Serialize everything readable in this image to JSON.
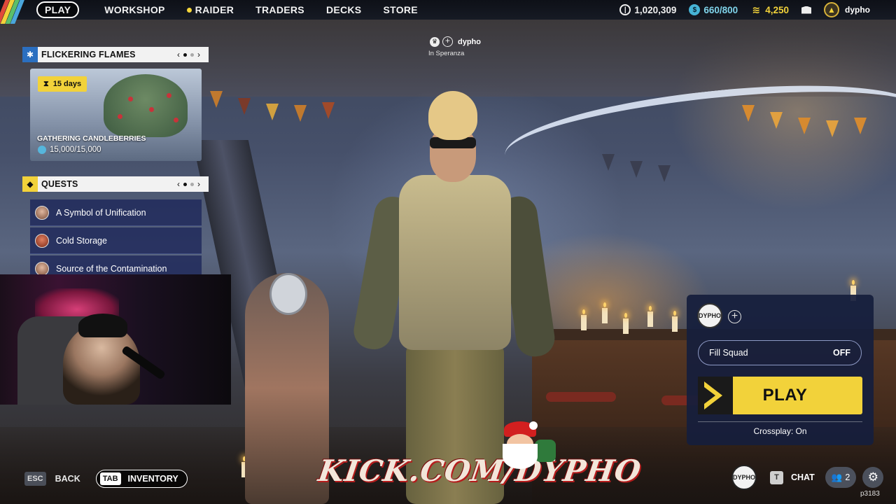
{
  "nav": {
    "items": [
      {
        "label": "PLAY",
        "active": true
      },
      {
        "label": "WORKSHOP"
      },
      {
        "label": "RAIDER",
        "dot": true
      },
      {
        "label": "TRADERS"
      },
      {
        "label": "DECKS"
      },
      {
        "label": "STORE"
      }
    ]
  },
  "currencies": {
    "coins": "1,020,309",
    "tokens": "660/800",
    "credits": "4,250"
  },
  "user": {
    "name": "dypho"
  },
  "player_label": {
    "name": "dypho",
    "location": "In Speranza"
  },
  "event_panel": {
    "title": "FLICKERING FLAMES",
    "timer": "15  days",
    "name": "GATHERING CANDLEBERRIES",
    "progress": "15,000/15,000"
  },
  "quests_panel": {
    "title": "QUESTS",
    "items": [
      {
        "label": "A Symbol of Unification"
      },
      {
        "label": "Cold Storage"
      },
      {
        "label": "Source of the Contamination"
      }
    ]
  },
  "squad": {
    "fill_label": "Fill Squad",
    "fill_state": "OFF",
    "play_label": "PLAY",
    "crossplay": "Crossplay: On",
    "emblem_text": "DYPHO"
  },
  "bottom": {
    "esc_key": "ESC",
    "back_label": "BACK",
    "tab_key": "TAB",
    "inventory_label": "INVENTORY",
    "t_key": "T",
    "chat_label": "CHAT",
    "friends_count": "2",
    "build": "p3183"
  },
  "overlay": {
    "kick_text": "KICK.COM/DYPHO"
  },
  "colors": {
    "accent_yellow": "#f2d23a",
    "panel_navy": "#1e285a",
    "currency_blue": "#7fd3ea"
  }
}
